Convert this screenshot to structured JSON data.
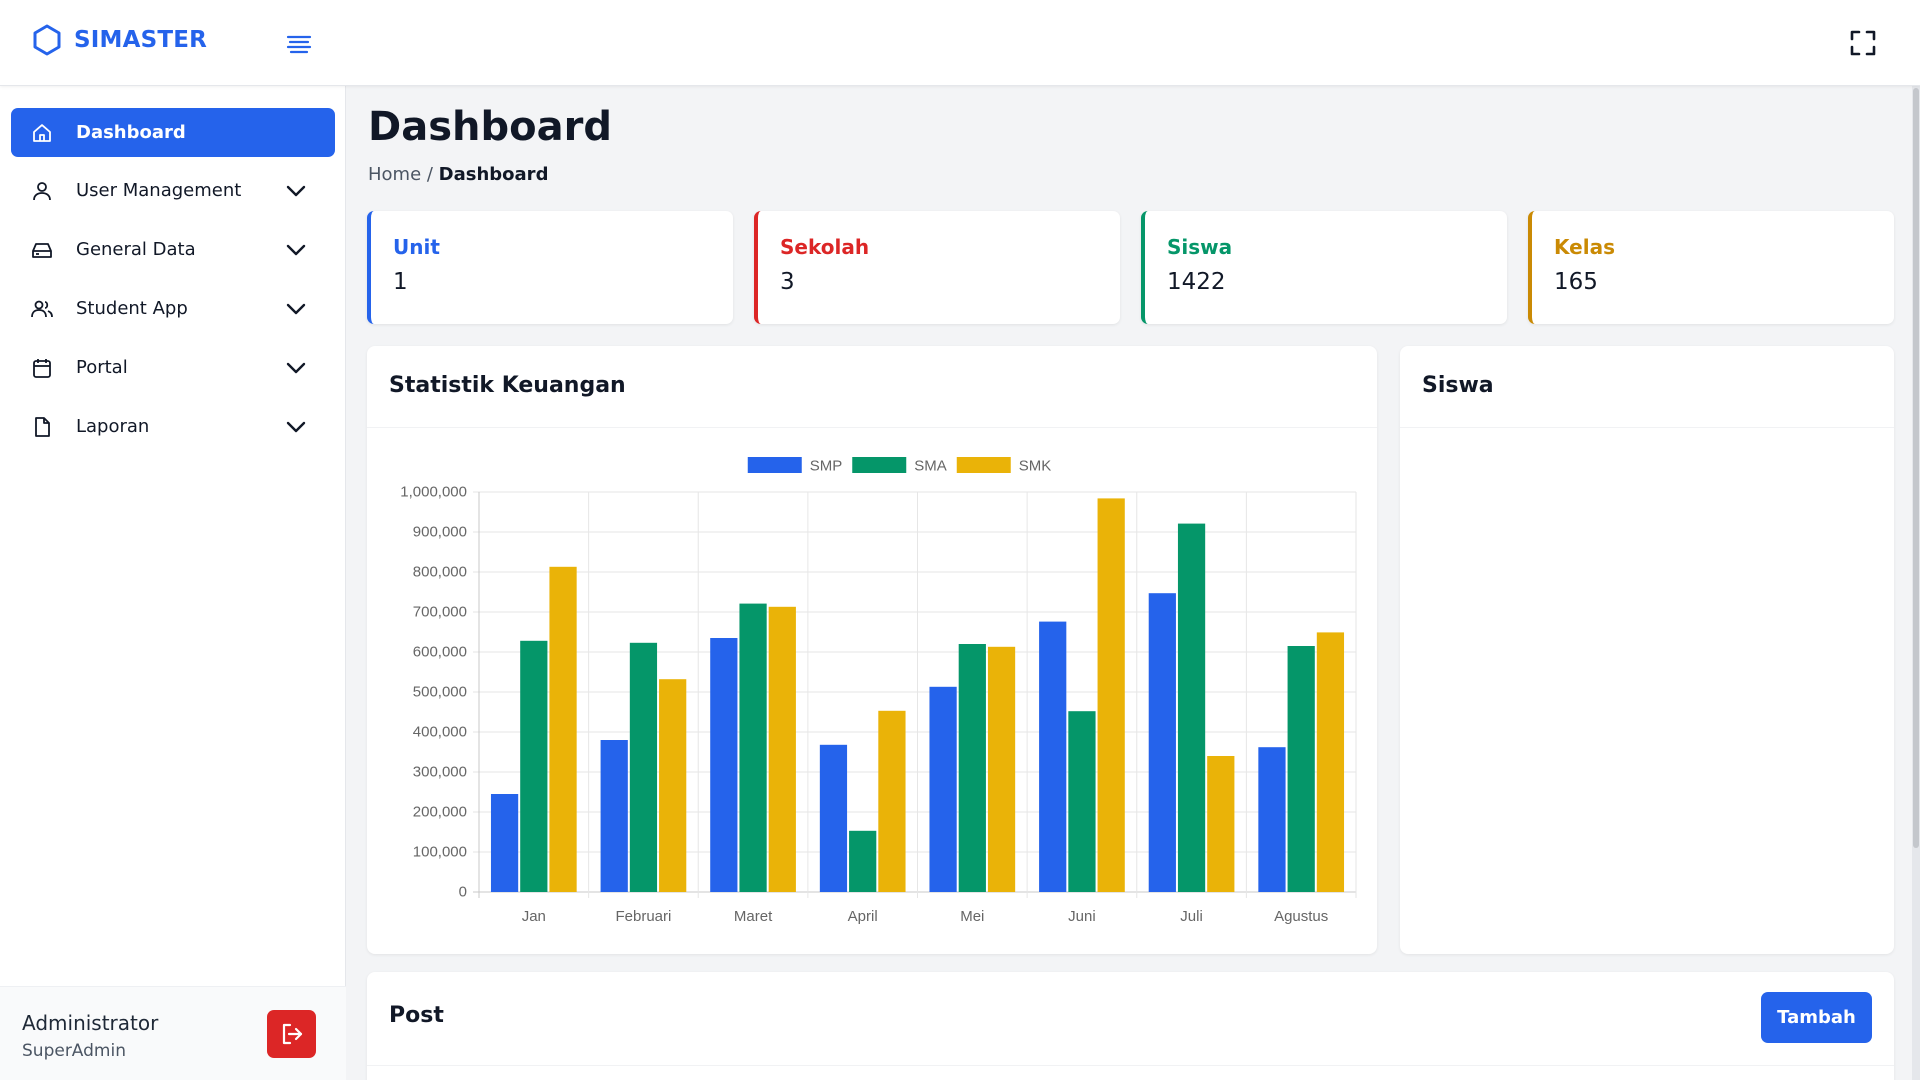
{
  "app": {
    "brand": "SIMASTER"
  },
  "sidebar": {
    "items": [
      {
        "label": "Dashboard",
        "icon": "home-icon",
        "active": true
      },
      {
        "label": "User Management",
        "icon": "user-icon"
      },
      {
        "label": "General Data",
        "icon": "drive-icon"
      },
      {
        "label": "Student App",
        "icon": "users-icon"
      },
      {
        "label": "Portal",
        "icon": "calendar-icon"
      },
      {
        "label": "Laporan",
        "icon": "file-icon"
      }
    ],
    "user": {
      "name": "Administrator",
      "role": "SuperAdmin"
    }
  },
  "page": {
    "title": "Dashboard",
    "breadcrumb": {
      "home": "Home",
      "separator": " / ",
      "current": "Dashboard"
    }
  },
  "stats": [
    {
      "label": "Unit",
      "value": "1",
      "color": "#2563eb"
    },
    {
      "label": "Sekolah",
      "value": "3",
      "color": "#dc2626"
    },
    {
      "label": "Siswa",
      "value": "1422",
      "color": "#059669"
    },
    {
      "label": "Kelas",
      "value": "165",
      "color": "#ca8a04"
    }
  ],
  "cards": {
    "finance": {
      "title": "Statistik Keuangan"
    },
    "students": {
      "title": "Siswa"
    },
    "post": {
      "title": "Post",
      "add_button": "Tambah"
    }
  },
  "colors": {
    "primary": "#2563eb",
    "danger": "#dc2626",
    "smp": "#2563eb",
    "sma": "#059669",
    "smk": "#eab308"
  },
  "chart_data": {
    "type": "bar",
    "title": "",
    "xlabel": "",
    "ylabel": "",
    "categories": [
      "Jan",
      "Februari",
      "Maret",
      "April",
      "Mei",
      "Juni",
      "Juli",
      "Agustus"
    ],
    "series": [
      {
        "name": "SMP",
        "color": "#2563eb",
        "values": [
          245000,
          380000,
          635000,
          368000,
          513000,
          676000,
          747000,
          362000
        ]
      },
      {
        "name": "SMA",
        "color": "#059669",
        "values": [
          628000,
          623000,
          721000,
          153000,
          620000,
          452000,
          921000,
          615000
        ]
      },
      {
        "name": "SMK",
        "color": "#eab308",
        "values": [
          813000,
          532000,
          713000,
          453000,
          613000,
          984000,
          340000,
          649000
        ]
      }
    ],
    "ylim": [
      0,
      1000000
    ],
    "yticks": [
      "0",
      "100,000",
      "200,000",
      "300,000",
      "400,000",
      "500,000",
      "600,000",
      "700,000",
      "800,000",
      "900,000",
      "1,000,000"
    ],
    "grid": true,
    "legend": "top-center"
  }
}
